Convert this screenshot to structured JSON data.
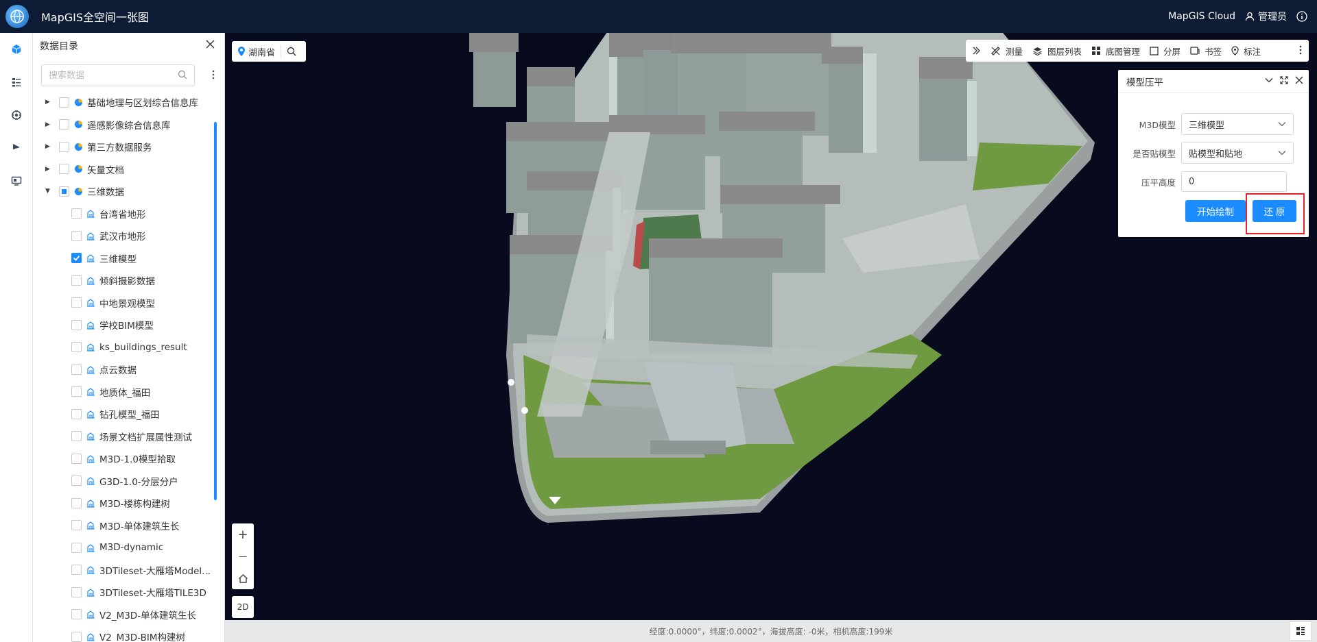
{
  "header": {
    "title": "MapGIS全空间一张图",
    "cloud_label": "MapGIS Cloud",
    "user_label": "管理员"
  },
  "rail": {
    "items": [
      {
        "icon": "cube-icon",
        "active": true
      },
      {
        "icon": "list-icon",
        "active": false
      },
      {
        "icon": "globe-gear-icon",
        "active": false
      },
      {
        "icon": "flag-icon",
        "active": false
      },
      {
        "icon": "monitor-icon",
        "active": false
      }
    ]
  },
  "catalog": {
    "title": "数据目录",
    "search_placeholder": "搜索数据",
    "groups": [
      {
        "label": "基础地理与区划综合信息库",
        "expanded": false
      },
      {
        "label": "遥感影像综合信息库",
        "expanded": false
      },
      {
        "label": "第三方数据服务",
        "expanded": false
      },
      {
        "label": "矢量文档",
        "expanded": false
      },
      {
        "label": "三维数据",
        "expanded": true
      }
    ],
    "children": [
      {
        "label": "台湾省地形",
        "checked": false
      },
      {
        "label": "武汉市地形",
        "checked": false
      },
      {
        "label": "三维模型",
        "checked": true
      },
      {
        "label": "倾斜摄影数据",
        "checked": false
      },
      {
        "label": "中地景观模型",
        "checked": false
      },
      {
        "label": "学校BIM模型",
        "checked": false
      },
      {
        "label": "ks_buildings_result",
        "checked": false
      },
      {
        "label": "点云数据",
        "checked": false
      },
      {
        "label": "地质体_福田",
        "checked": false
      },
      {
        "label": "钻孔模型_福田",
        "checked": false
      },
      {
        "label": "场景文档扩展属性测试",
        "checked": false
      },
      {
        "label": "M3D-1.0模型拾取",
        "checked": false
      },
      {
        "label": "G3D-1.0-分层分户",
        "checked": false
      },
      {
        "label": "M3D-楼栋构建树",
        "checked": false
      },
      {
        "label": "M3D-单体建筑生长",
        "checked": false
      },
      {
        "label": "M3D-dynamic",
        "checked": false
      },
      {
        "label": "3DTileset-大雁塔Model...",
        "checked": false
      },
      {
        "label": "3DTileset-大雁塔TILE3D",
        "checked": false
      },
      {
        "label": "V2_M3D-单体建筑生长",
        "checked": false
      },
      {
        "label": "V2_M3D-BIM构建树",
        "checked": false
      }
    ]
  },
  "map": {
    "location": "湖南省",
    "toolbar": {
      "measure": "测量",
      "layers": "图层列表",
      "basemap": "底图管理",
      "split": "分屏",
      "bookmark": "书签",
      "mark": "标注"
    },
    "zoom_in": "+",
    "zoom_out": "—",
    "mode": "2D",
    "status": "经度:0.0000°，纬度:0.0002°，海拔高度: -0米，相机高度:199米"
  },
  "flatten_panel": {
    "title": "模型压平",
    "model_label": "M3D模型",
    "model_value": "三维模型",
    "attach_label": "是否贴模型",
    "attach_value": "贴模型和贴地",
    "height_label": "压平高度",
    "height_value": "0",
    "start_button": "开始绘制",
    "restore_button": "还 原"
  },
  "colors": {
    "accent": "#1a8cff",
    "topbar": "#0d1c34",
    "map_bg": "#070b1d",
    "highlight": "#e8202a"
  }
}
